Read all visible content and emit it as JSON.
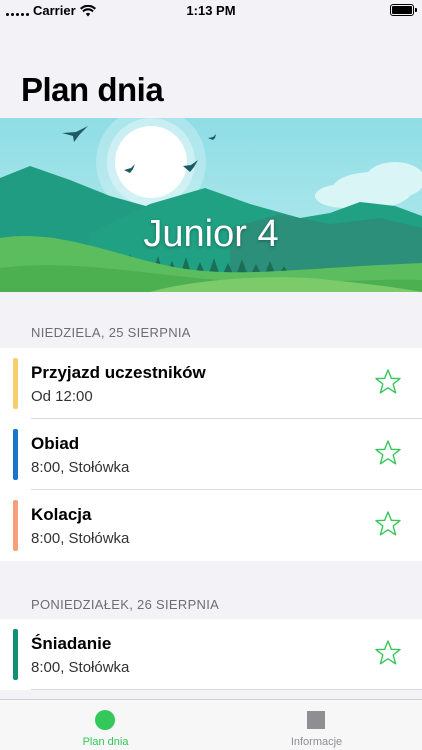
{
  "status_bar": {
    "carrier": "Carrier",
    "time": "1:13 PM"
  },
  "nav": {
    "title": "Plan dnia"
  },
  "hero": {
    "title": "Junior 4"
  },
  "sections": [
    {
      "header": "NIEDZIELA, 25 SIERPNIA",
      "items": [
        {
          "title": "Przyjazd uczestników",
          "subtitle": "Od 12:00",
          "accent_color": "#f5ce6e"
        },
        {
          "title": "Obiad",
          "subtitle": "8:00, Stołówka",
          "accent_color": "#1877c9"
        },
        {
          "title": "Kolacja",
          "subtitle": "8:00, Stołówka",
          "accent_color": "#f5a07a"
        }
      ]
    },
    {
      "header": "PONIEDZIAŁEK, 26 SIERPNIA",
      "items": [
        {
          "title": "Śniadanie",
          "subtitle": "8:00, Stołówka",
          "accent_color": "#129075"
        }
      ]
    }
  ],
  "tabs": [
    {
      "label": "Plan dnia",
      "icon": "circle-icon",
      "active": true
    },
    {
      "label": "Informacje",
      "icon": "square-icon",
      "active": false
    }
  ],
  "colors": {
    "accent": "#34c759",
    "inactive": "#8e8e93",
    "background": "#f2f2f7"
  }
}
